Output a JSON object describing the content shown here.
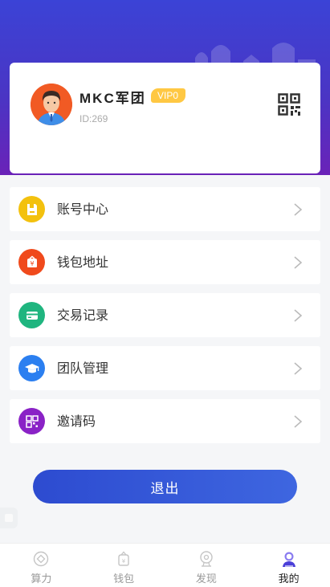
{
  "profile": {
    "username": "MKC军团",
    "vip_badge": "VIP0",
    "user_id": "ID:269"
  },
  "menu": [
    {
      "label": "账号中心",
      "icon": "account-icon",
      "color": "#f3c10e"
    },
    {
      "label": "钱包地址",
      "icon": "wallet-address-icon",
      "color": "#f04a1c"
    },
    {
      "label": "交易记录",
      "icon": "transaction-card-icon",
      "color": "#1fb57f"
    },
    {
      "label": "团队管理",
      "icon": "team-graduation-icon",
      "color": "#2b7ff0"
    },
    {
      "label": "邀请码",
      "icon": "invite-qr-icon",
      "color": "#8a22c6"
    }
  ],
  "logout_label": "退出",
  "tabs": [
    {
      "label": "算力",
      "icon": "hashrate-icon",
      "active": false
    },
    {
      "label": "钱包",
      "icon": "wallet-icon",
      "active": false
    },
    {
      "label": "发现",
      "icon": "discover-icon",
      "active": false
    },
    {
      "label": "我的",
      "icon": "profile-icon",
      "active": true
    }
  ],
  "colors": {
    "header_gradient_top": "#3b43d6",
    "header_gradient_bottom": "#6a22b8",
    "vip": "#ffc843",
    "logout_button": "#3158d8",
    "active_tab_icon": "#4b3fd8"
  }
}
